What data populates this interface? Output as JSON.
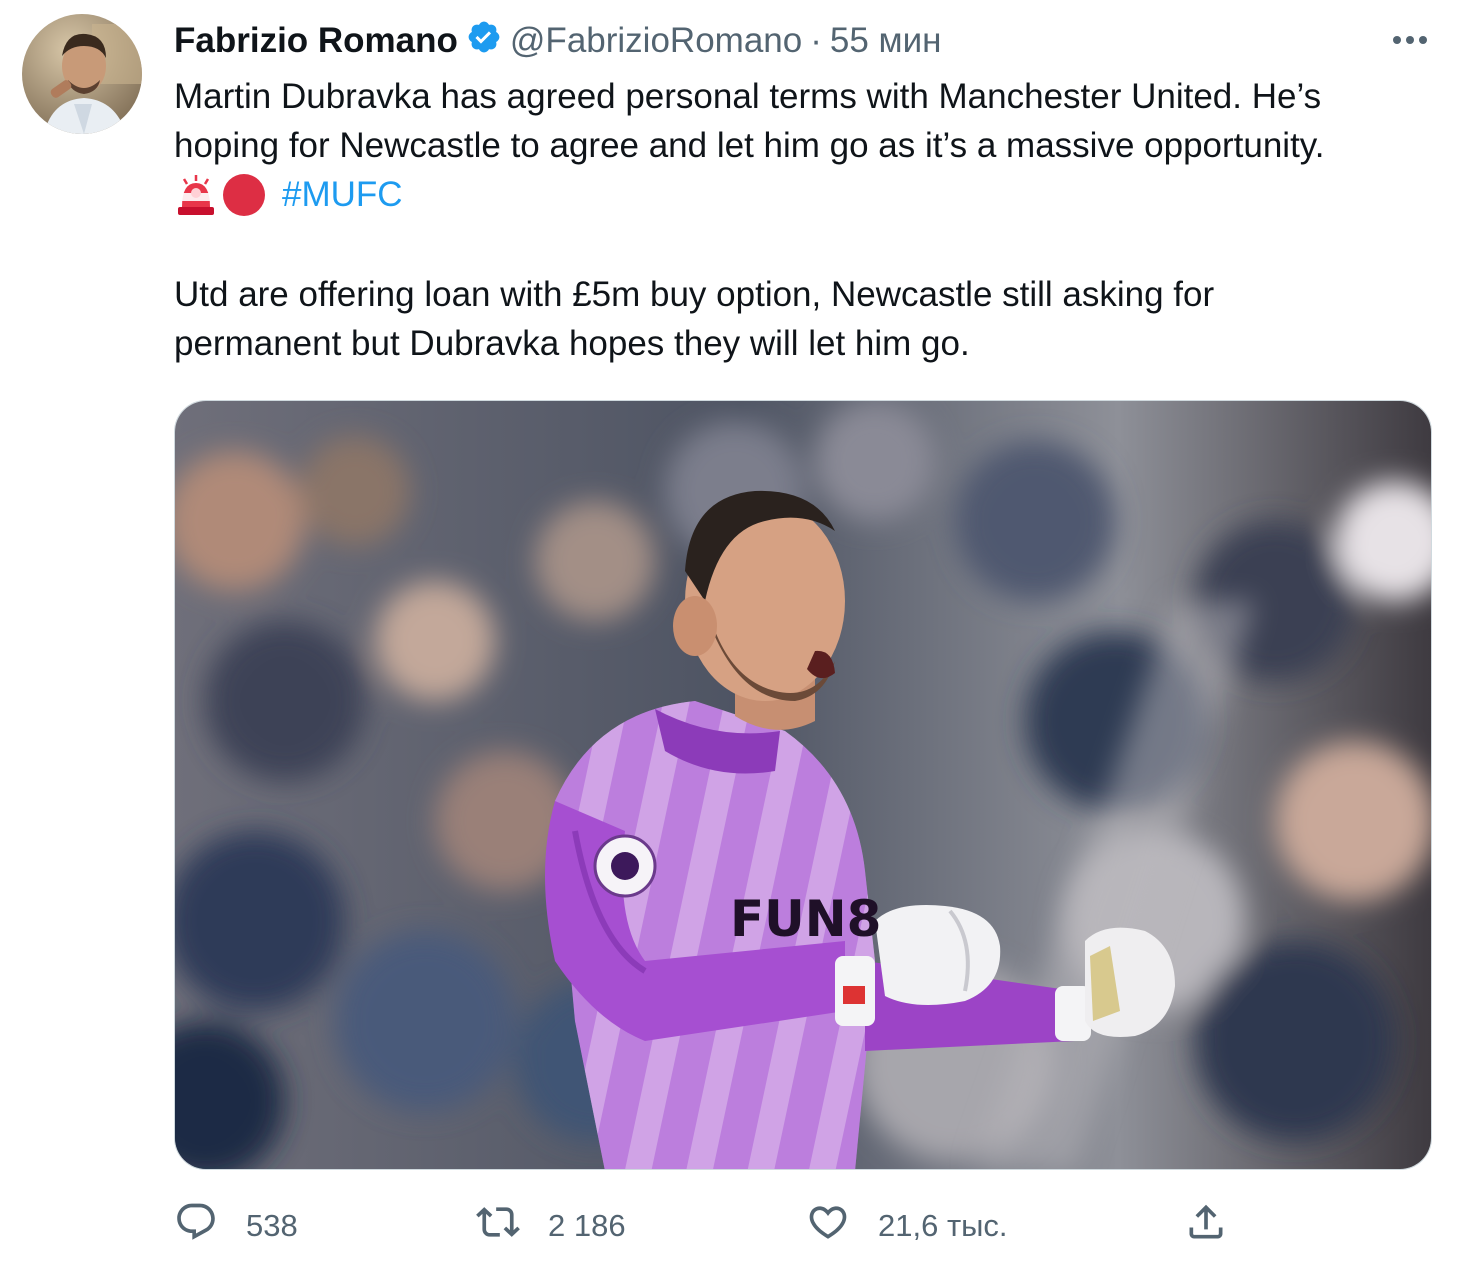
{
  "author": {
    "display_name": "Fabrizio Romano",
    "handle": "@FabrizioRomano",
    "separator": "·",
    "time": "55 мин"
  },
  "tweet": {
    "line1": "Martin Dubravka has agreed personal terms with Manchester United. He’s",
    "line2": "hoping for Newcastle to agree and let him go as it’s a massive opportunity.",
    "emojis": [
      "police-light",
      "red-circle"
    ],
    "hashtag": "#MUFC",
    "line4": "Utd are offering loan with £5m buy option, Newcastle still asking for",
    "line5": "permanent but Dubravka hopes they will let him go.",
    "media_jersey_text": "FUN8"
  },
  "stats": {
    "replies": "538",
    "retweets": "2 186",
    "likes": "21,6 тыс."
  },
  "icons": {
    "verified": "verified-badge-icon",
    "more": "more-dots-icon",
    "reply": "reply-icon",
    "retweet": "retweet-icon",
    "like": "heart-icon",
    "share": "share-icon"
  },
  "colors": {
    "link": "#1d9bf0",
    "secondary_text": "#536471",
    "primary_text": "#0f1419",
    "jersey_purple": "#a64fd1"
  }
}
